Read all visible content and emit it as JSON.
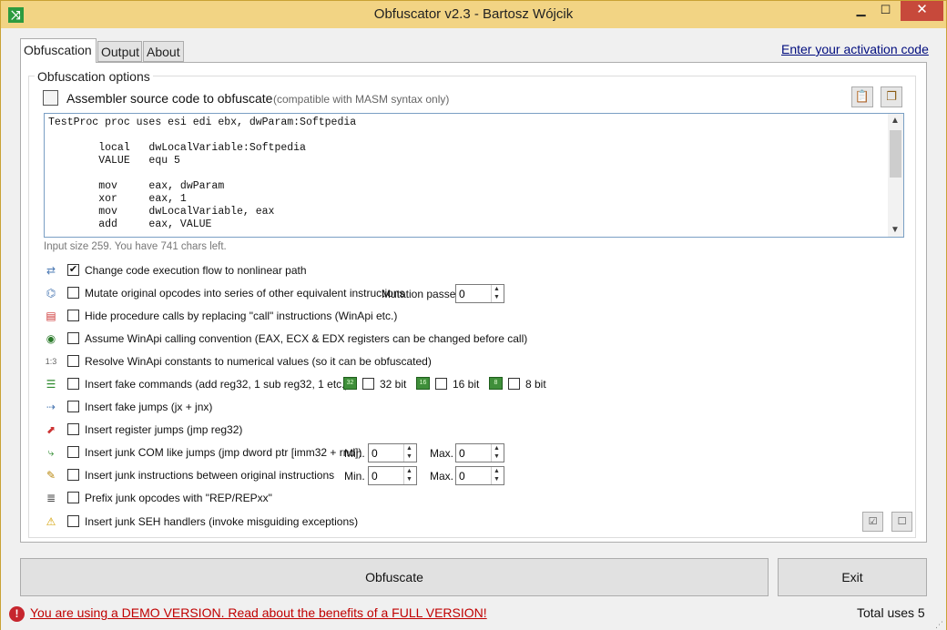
{
  "window": {
    "title": "Obfuscator v2.3 - Bartosz Wójcik",
    "min_glyph": "▁",
    "max_glyph": "☐",
    "close_glyph": "✕"
  },
  "tabs": {
    "obfuscation": "Obfuscation",
    "output": "Output",
    "about": "About"
  },
  "activation_link": "Enter your activation code",
  "options_group": {
    "title": "Obfuscation options",
    "asm_label": "Assembler source code to obfuscate",
    "asm_note": "(compatible with MASM syntax only)"
  },
  "code": {
    "lines": [
      "TestProc proc uses esi edi ebx, dwParam:Softpedia",
      "",
      "        local   dwLocalVariable:Softpedia",
      "        VALUE   equ 5",
      "",
      "        mov     eax, dwParam",
      "        xor     eax, 1",
      "        mov     dwLocalVariable, eax",
      "        add     eax, VALUE"
    ]
  },
  "input_status": "Input size 259. You have 741 chars left.",
  "options": [
    {
      "label": "Change code execution flow to nonlinear path",
      "checked": true,
      "icon": "flow-icon"
    },
    {
      "label": "Mutate original opcodes into series of other equivalent instructions",
      "checked": false,
      "icon": "tree-icon"
    },
    {
      "label": "Hide procedure calls by replacing \"call\" instructions (WinApi etc.)",
      "checked": false,
      "icon": "call-icon"
    },
    {
      "label": "Assume WinApi calling convention (EAX, ECX & EDX registers can be changed before call)",
      "checked": false,
      "icon": "windows-icon"
    },
    {
      "label": "Resolve WinApi constants to numerical values (so it can be obfuscated)",
      "checked": false,
      "icon": "numbers-icon"
    },
    {
      "label": "Insert fake commands (add reg32, 1 sub reg32, 1 etc.)",
      "checked": false,
      "icon": "fake-commands-icon"
    },
    {
      "label": "Insert fake jumps (jx + jnx)",
      "checked": false,
      "icon": "fake-jumps-icon"
    },
    {
      "label": "Insert register jumps (jmp reg32)",
      "checked": false,
      "icon": "register-jumps-icon"
    },
    {
      "label": "Insert junk COM like jumps (jmp dword ptr [imm32 + rnd])",
      "checked": false,
      "icon": "com-jumps-icon"
    },
    {
      "label": "Insert junk instructions between original instructions",
      "checked": false,
      "icon": "junk-instructions-icon"
    },
    {
      "label": "Prefix junk opcodes with \"REP/REPxx\"",
      "checked": false,
      "icon": "prefix-icon"
    },
    {
      "label": "Insert junk SEH handlers (invoke misguiding exceptions)",
      "checked": false,
      "icon": "warning-icon"
    }
  ],
  "mutation": {
    "label": "Mutation passes",
    "value": "0"
  },
  "bits": {
    "b32": {
      "badge": "32",
      "label": "32 bit"
    },
    "b16": {
      "badge": "16",
      "label": "16 bit"
    },
    "b8": {
      "badge": "8",
      "label": "8 bit"
    }
  },
  "com_jumps": {
    "min_label": "Min.",
    "min": "0",
    "max_label": "Max.",
    "max": "0"
  },
  "junk_instr": {
    "min_label": "Min.",
    "min": "0",
    "max_label": "Max.",
    "max": "0"
  },
  "buttons": {
    "obfuscate": "Obfuscate",
    "exit": "Exit",
    "check_all": "☑",
    "uncheck_all": "☐"
  },
  "status": {
    "demo_text": "You are using a DEMO VERSION. Read about the benefits of a FULL VERSION!",
    "total_uses": "Total uses 5"
  },
  "colors": {
    "titlebar": "#f2d484",
    "close": "#c7493b",
    "link": "#000c7e",
    "demo": "#c00000"
  }
}
